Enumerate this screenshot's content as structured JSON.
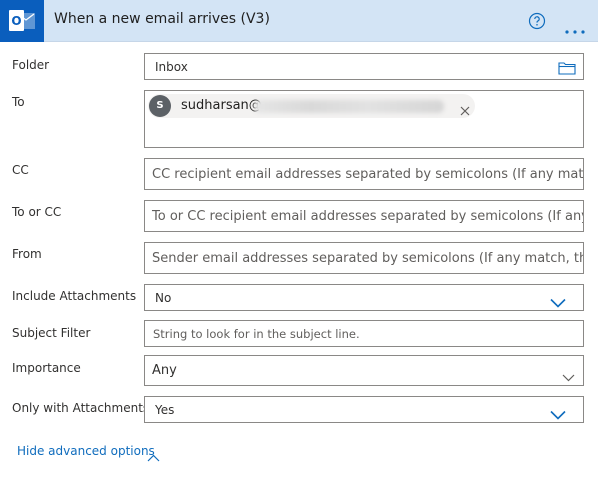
{
  "header": {
    "title": "When a new email arrives (V3)",
    "icon": "outlook-icon",
    "accent_color": "#0a5ebd",
    "background_color": "#d3e4f5"
  },
  "fields": {
    "folder": {
      "label": "Folder",
      "value": "Inbox",
      "icon": "folder-icon"
    },
    "to": {
      "label": "To",
      "recipients": [
        {
          "initial": "S",
          "name": "sudharsan@"
        }
      ]
    },
    "cc": {
      "label": "CC",
      "placeholder": "CC recipient email addresses separated by semicolons (If any match, t"
    },
    "to_or_cc": {
      "label": "To or CC",
      "placeholder": "To or CC recipient email addresses separated by semicolons (If any m"
    },
    "from": {
      "label": "From",
      "placeholder": "Sender email addresses separated by semicolons (If any match, the tr"
    },
    "include_attachments": {
      "label": "Include Attachments",
      "value": "No"
    },
    "subject_filter": {
      "label": "Subject Filter",
      "placeholder": "String to look for in the subject line."
    },
    "importance": {
      "label": "Importance",
      "value": "Any"
    },
    "only_with_attachments": {
      "label": "Only with Attachments",
      "value": "Yes"
    }
  },
  "footer": {
    "hide_advanced_label": "Hide advanced options"
  },
  "colors": {
    "link": "#0f6cbd",
    "dropdown_chevron": "#0f6cbd",
    "border": "#8a8886"
  }
}
